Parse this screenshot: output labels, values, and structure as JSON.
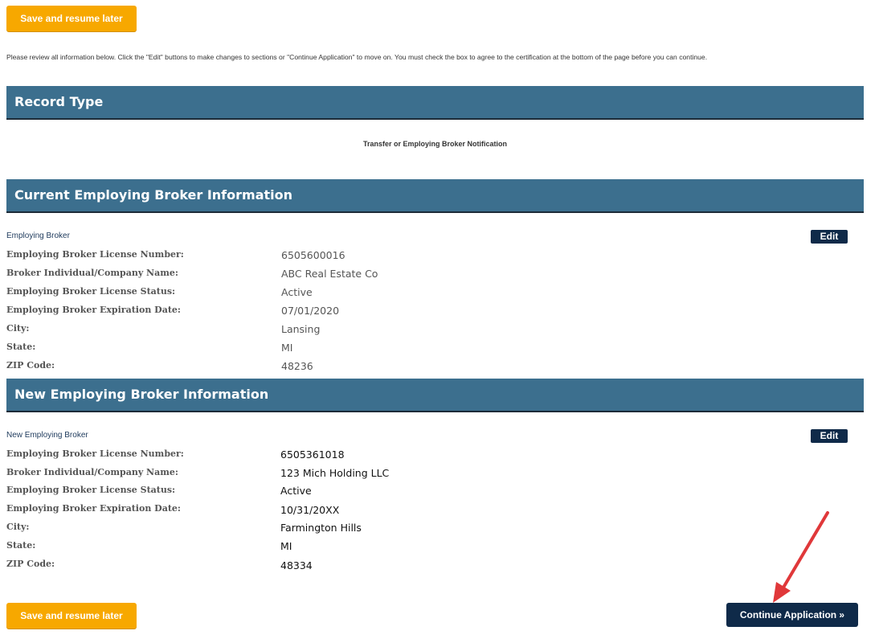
{
  "top_actions": {
    "save_label": "Save and resume later"
  },
  "instructions": "Please review all information below. Click the \"Edit\" buttons to make changes to sections or \"Continue Application\" to move on. You must check the box to agree to the certification at the bottom of the page before you can continue.",
  "record_type": {
    "title": "Record Type",
    "value": "Transfer or Employing Broker Notification"
  },
  "current_broker": {
    "title": "Current Employing Broker Information",
    "subtitle": "Employing Broker",
    "edit_label": "Edit",
    "fields": [
      {
        "label": "Employing Broker License Number:",
        "value": "6505600016"
      },
      {
        "label": "Broker Individual/Company Name:",
        "value": "ABC Real Estate Co"
      },
      {
        "label": "Employing Broker License Status:",
        "value": "Active"
      },
      {
        "label": "Employing Broker Expiration Date:",
        "value": "07/01/2020"
      },
      {
        "label": "City:",
        "value": "Lansing"
      },
      {
        "label": "State:",
        "value": "MI"
      },
      {
        "label": "ZIP Code:",
        "value": "48236"
      }
    ]
  },
  "new_broker": {
    "title": "New Employing Broker Information",
    "subtitle": "New Employing Broker",
    "edit_label": "Edit",
    "fields": [
      {
        "label": "Employing Broker License Number:",
        "value": "6505361018"
      },
      {
        "label": "Broker Individual/Company Name:",
        "value": "123 Mich Holding LLC"
      },
      {
        "label": "Employing Broker License Status:",
        "value": "Active"
      },
      {
        "label": "Employing Broker Expiration Date:",
        "value": "10/31/20XX"
      },
      {
        "label": "City:",
        "value": "Farmington Hills"
      },
      {
        "label": "State:",
        "value": "MI"
      },
      {
        "label": "ZIP Code:",
        "value": "48334"
      }
    ]
  },
  "bottom_actions": {
    "save_label": "Save and resume later",
    "continue_label": "Continue Application »"
  },
  "colors": {
    "accent_orange": "#f7a800",
    "section_header": "#3c6f8e",
    "navy_button": "#0f2a49",
    "arrow": "#e0383a"
  }
}
